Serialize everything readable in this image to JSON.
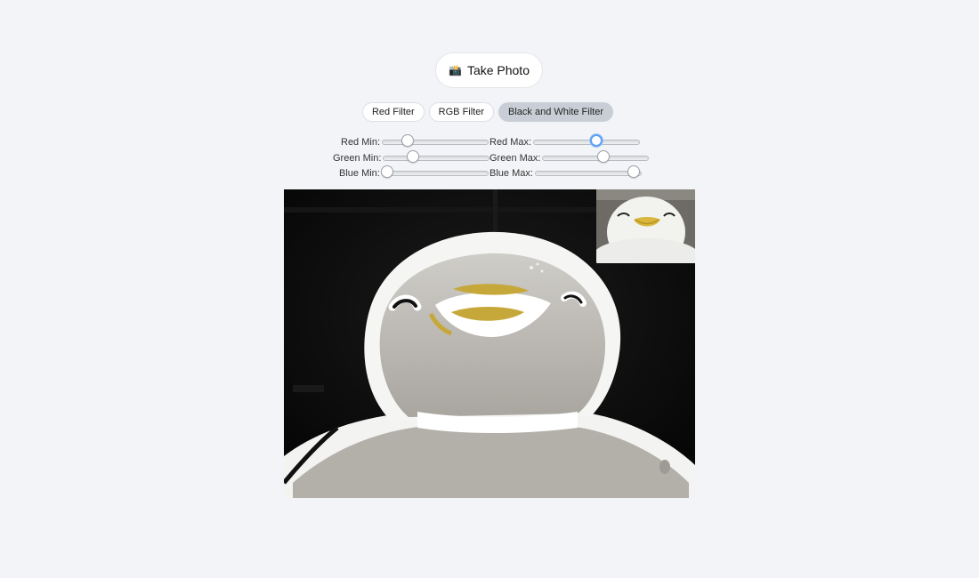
{
  "camera": {
    "take_photo_label": "Take Photo",
    "take_photo_icon": "camera-icon"
  },
  "filters": [
    {
      "label": "Red Filter",
      "active": false
    },
    {
      "label": "RGB Filter",
      "active": false
    },
    {
      "label": "Black and White Filter",
      "active": true
    }
  ],
  "sliders": {
    "red_min": {
      "label": "Red Min:",
      "value": 0.24
    },
    "red_max": {
      "label": "Red Max:",
      "value": 0.59
    },
    "green_min": {
      "label": "Green Min:",
      "value": 0.28
    },
    "green_max": {
      "label": "Green Max:",
      "value": 0.57
    },
    "blue_min": {
      "label": "Blue Min:",
      "value": 0.04
    },
    "blue_max": {
      "label": "Blue Max:",
      "value": 0.93
    }
  }
}
